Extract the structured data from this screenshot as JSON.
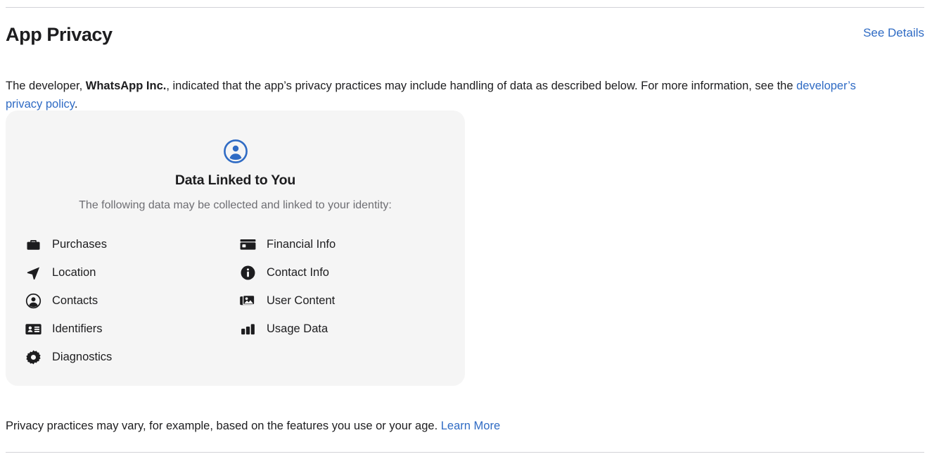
{
  "section": {
    "title": "App Privacy",
    "see_details_label": "See Details"
  },
  "intro": {
    "part1": "The developer, ",
    "developer_name": "WhatsApp Inc.",
    "part2": ", indicated that the app’s privacy practices may include handling of data as described below. For more information, see the ",
    "policy_link_label": "developer’s privacy policy",
    "part3": "."
  },
  "card": {
    "icon": "person-circle-icon",
    "icon_color": "#2f6bc4",
    "title": "Data Linked to You",
    "subtitle": "The following data may be collected and linked to your identity:",
    "background_color": "#f5f5f5",
    "items": [
      {
        "label": "Purchases",
        "icon": "briefcase-icon"
      },
      {
        "label": "Location",
        "icon": "location-arrow-icon"
      },
      {
        "label": "Contacts",
        "icon": "person-circle-icon"
      },
      {
        "label": "Identifiers",
        "icon": "id-card-icon"
      },
      {
        "label": "Diagnostics",
        "icon": "gear-icon"
      },
      {
        "label": "Financial Info",
        "icon": "credit-card-icon"
      },
      {
        "label": "Contact Info",
        "icon": "info-circle-icon"
      },
      {
        "label": "User Content",
        "icon": "photo-stack-icon"
      },
      {
        "label": "Usage Data",
        "icon": "bar-chart-icon"
      }
    ]
  },
  "footnote": {
    "text": "Privacy practices may vary, for example, based on the features you use or your age. ",
    "link_label": "Learn More"
  },
  "colors": {
    "link": "#2f6bc4",
    "text": "#1d1d1f",
    "muted": "#6e6e73",
    "divider": "#d2d2d7"
  }
}
